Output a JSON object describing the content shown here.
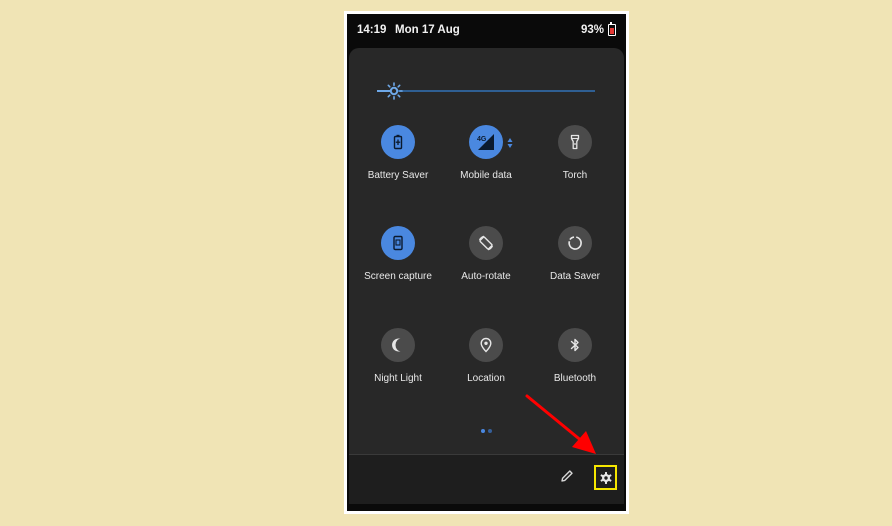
{
  "status_bar": {
    "time": "14:19",
    "date": "Mon 17 Aug",
    "battery": "93%"
  },
  "tiles": [
    {
      "label": "Battery Saver",
      "active": true,
      "icon": "battery-saver-icon"
    },
    {
      "label": "Mobile data",
      "active": true,
      "icon": "mobile-data-icon",
      "badge": "4G"
    },
    {
      "label": "Torch",
      "active": false,
      "icon": "torch-icon"
    },
    {
      "label": "Screen capture",
      "active": true,
      "icon": "screen-capture-icon"
    },
    {
      "label": "Auto-rotate",
      "active": false,
      "icon": "auto-rotate-icon"
    },
    {
      "label": "Data Saver",
      "active": false,
      "icon": "data-saver-icon"
    },
    {
      "label": "Night Light",
      "active": false,
      "icon": "night-light-icon"
    },
    {
      "label": "Location",
      "active": false,
      "icon": "location-icon"
    },
    {
      "label": "Bluetooth",
      "active": false,
      "icon": "bluetooth-icon"
    }
  ],
  "colors": {
    "accent": "#4a88e0",
    "tile_off": "#4b4b4b",
    "panel": "#282828",
    "highlight": "#f5e600",
    "arrow": "#ff0000"
  }
}
